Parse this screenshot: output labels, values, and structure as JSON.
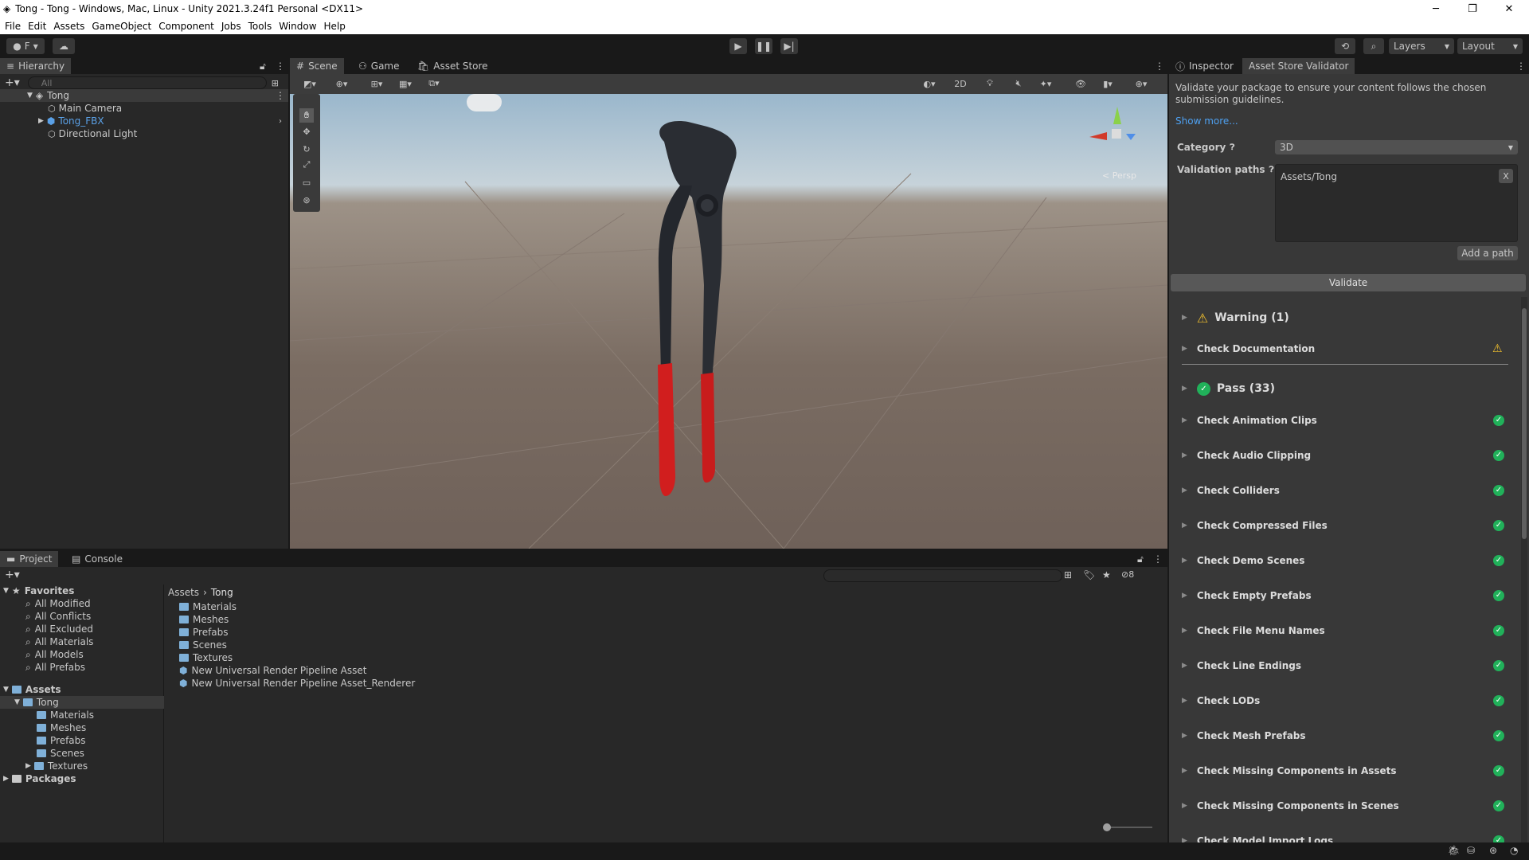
{
  "window": {
    "title": "Tong - Tong - Windows, Mac, Linux - Unity 2021.3.24f1 Personal <DX11>"
  },
  "menu": [
    "File",
    "Edit",
    "Assets",
    "GameObject",
    "Component",
    "Jobs",
    "Tools",
    "Window",
    "Help"
  ],
  "toolbar": {
    "account": "F",
    "layers": "Layers",
    "layout": "Layout"
  },
  "hierarchy": {
    "tab": "Hierarchy",
    "search_placeholder": "All",
    "scene": "Tong",
    "items": [
      "Main Camera",
      "Tong_FBX",
      "Directional Light"
    ]
  },
  "scene_view": {
    "tabs": [
      "Scene",
      "Game",
      "Asset Store"
    ],
    "mode_2d": "2D",
    "persp": "< Persp"
  },
  "project": {
    "tabs": [
      "Project",
      "Console"
    ],
    "favorites_label": "Favorites",
    "favorites": [
      "All Modified",
      "All Conflicts",
      "All Excluded",
      "All Materials",
      "All Models",
      "All Prefabs"
    ],
    "assets_label": "Assets",
    "tree_tong": "Tong",
    "tree_sub": [
      "Materials",
      "Meshes",
      "Prefabs",
      "Scenes",
      "Textures"
    ],
    "packages_label": "Packages",
    "breadcrumb": [
      "Assets",
      "Tong"
    ],
    "files": [
      "Materials",
      "Meshes",
      "Prefabs",
      "Scenes",
      "Textures",
      "New Universal Render Pipeline Asset",
      "New Universal Render Pipeline Asset_Renderer"
    ],
    "hidden_count": "8"
  },
  "inspector": {
    "tabs": [
      "Inspector",
      "Asset Store Validator"
    ],
    "intro": "Validate your package to ensure your content follows the chosen submission guidelines.",
    "show_more": "Show more...",
    "category_label": "Category",
    "category_value": "3D",
    "paths_label": "Validation paths",
    "path_value": "Assets/Tong",
    "remove_btn": "X",
    "add_path": "Add a path",
    "validate": "Validate",
    "warning_header": "Warning (1)",
    "warning_items": [
      "Check Documentation"
    ],
    "pass_header": "Pass (33)",
    "pass_items": [
      "Check Animation Clips",
      "Check Audio Clipping",
      "Check Colliders",
      "Check Compressed Files",
      "Check Demo Scenes",
      "Check Empty Prefabs",
      "Check File Menu Names",
      "Check Line Endings",
      "Check LODs",
      "Check Mesh Prefabs",
      "Check Missing Components in Assets",
      "Check Missing Components in Scenes",
      "Check Model Import Logs"
    ]
  },
  "colors": {
    "accent": "#3a79bb",
    "pass": "#21b15a",
    "warning": "#f3c12d",
    "link": "#4ea0f0"
  }
}
